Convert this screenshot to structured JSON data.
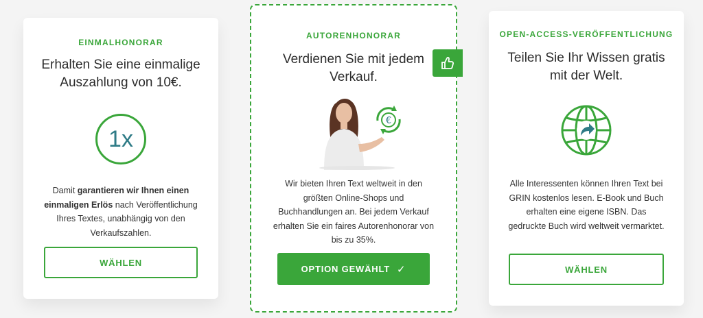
{
  "cards": [
    {
      "eyebrow": "EINMALHONORAR",
      "headline_line1": "Erhalten Sie eine einmalige",
      "headline_line2": "Auszahlung von 10€.",
      "ring_text": "1x",
      "desc": {
        "p1": "Damit ",
        "b1": "garantieren wir Ihnen einen einmaligen Erlös",
        "p2": " nach Veröffentlichung Ihres Textes, unabhängig von den Verkaufszahlen."
      },
      "button_label": "WÄHLEN",
      "selected": false
    },
    {
      "eyebrow": "AUTORENHONORAR",
      "headline_line1": "Verdienen Sie mit jedem",
      "headline_line2": "Verkauf.",
      "illustration_icon": "euro-cycle-icon",
      "desc": "Wir bieten Ihren Text weltweit in den größten Online-Shops und Buchhandlungen an. Bei jedem Verkauf erhalten Sie ein faires Autorenhonorar von bis zu 35%.",
      "button_label": "OPTION GEWÄHLT",
      "button_check": "✓",
      "selected": true,
      "badge_icon": "thumbs-up-icon"
    },
    {
      "eyebrow": "OPEN-ACCESS-VERÖFFENTLICHUNG",
      "headline_line1": "Teilen Sie Ihr Wissen gratis",
      "headline_line2": "mit der Welt.",
      "illustration_icon": "globe-share-icon",
      "desc": "Alle Interessenten können Ihren Text bei GRIN kostenlos lesen. E-Book und Buch erhalten eine eigene ISBN. Das gedruckte Buch wird weltweit vermarktet.",
      "button_label": "WÄHLEN",
      "selected": false
    }
  ],
  "colors": {
    "accent": "#3aa63a",
    "ring_text": "#2e7b86",
    "background": "#f4f4f4"
  }
}
